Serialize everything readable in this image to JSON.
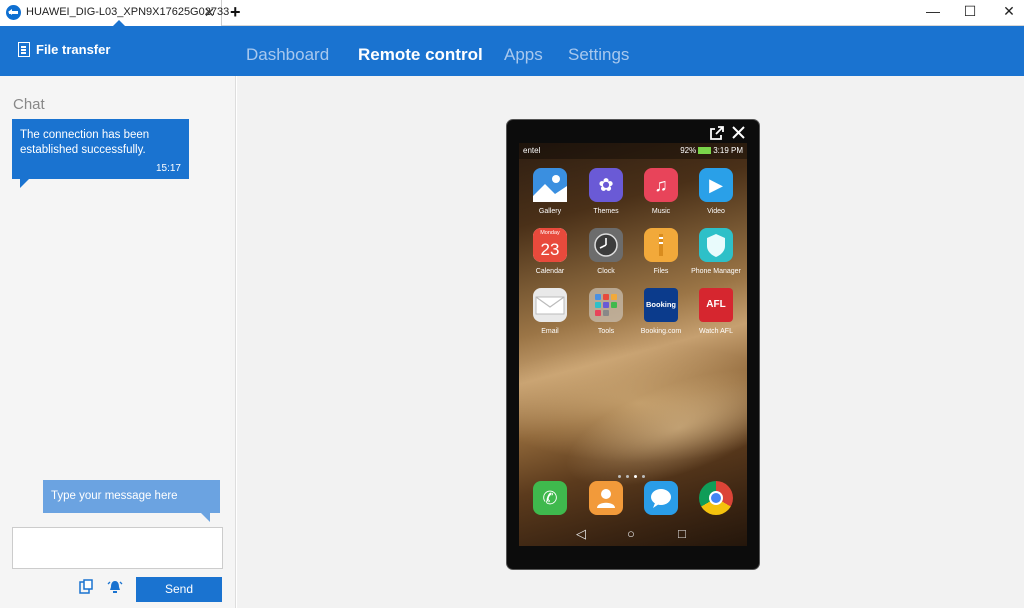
{
  "tab": {
    "title": "HUAWEI_DIG-L03_XPN9X17625G02733",
    "close": "✕",
    "new_tab": "+"
  },
  "window": {
    "minimize": "—",
    "maximize": "☐",
    "close": "✕"
  },
  "header": {
    "file_transfer": "File transfer",
    "nav": [
      {
        "label": "Dashboard",
        "active": false
      },
      {
        "label": "Remote control",
        "active": true
      },
      {
        "label": "Apps",
        "active": false
      },
      {
        "label": "Settings",
        "active": false
      }
    ]
  },
  "chat": {
    "title": "Chat",
    "message": {
      "text": "The connection has been established successfully.",
      "time": "15:17"
    },
    "input_hint": "Type your message here",
    "send": "Send"
  },
  "phone": {
    "status": {
      "carrier": "entel",
      "battery": "92%",
      "time": "3:19 PM"
    },
    "apps": [
      {
        "label": "Gallery",
        "icon": "gallery-icon",
        "color": "#3a8fe0"
      },
      {
        "label": "Themes",
        "icon": "themes-icon",
        "color": "#6a5ad6"
      },
      {
        "label": "Music",
        "icon": "music-icon",
        "color": "#e8445a"
      },
      {
        "label": "Video",
        "icon": "video-icon",
        "color": "#2aa0e8"
      },
      {
        "label": "Calendar",
        "icon": "calendar-icon",
        "color": "#e84a3c",
        "calendar_month": "Monday",
        "calendar_day": "23"
      },
      {
        "label": "Clock",
        "icon": "clock-icon",
        "color": "#6c6c6c"
      },
      {
        "label": "Files",
        "icon": "files-icon",
        "color": "#f2a93a"
      },
      {
        "label": "Phone Manager",
        "icon": "phone-manager-icon",
        "color": "#2ec0c8"
      },
      {
        "label": "Email",
        "icon": "email-icon",
        "color": "#e9e9e9"
      },
      {
        "label": "Tools",
        "icon": "tools-folder-icon",
        "color": "#b9b3a8"
      },
      {
        "label": "Booking.com",
        "icon": "booking-icon",
        "color": "#0b3b8c",
        "text": "Booking"
      },
      {
        "label": "Watch AFL",
        "icon": "watch-afl-icon",
        "color": "#d6262f",
        "text": "AFL"
      }
    ],
    "dock": [
      {
        "icon": "phone-icon",
        "color": "#3fb94d"
      },
      {
        "icon": "contacts-icon",
        "color": "#f29a3a"
      },
      {
        "icon": "messages-icon",
        "color": "#2a9de8"
      },
      {
        "icon": "chrome-icon",
        "color": "#ffffff"
      }
    ]
  }
}
